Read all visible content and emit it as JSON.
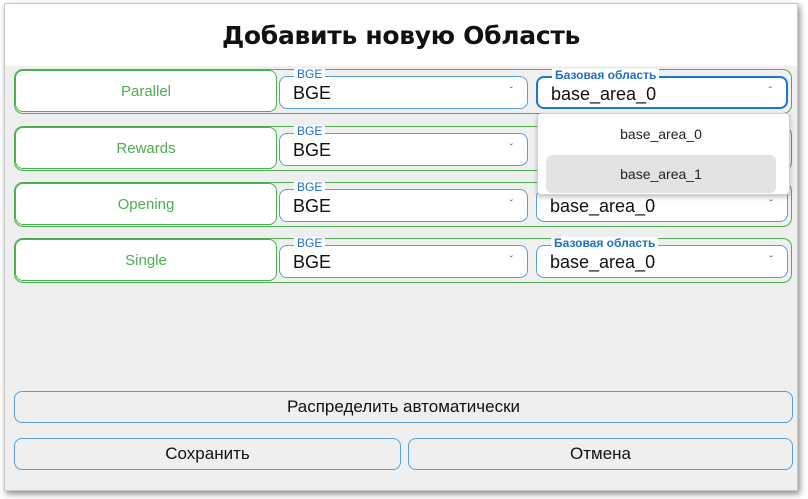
{
  "dialog": {
    "title": "Добавить новую Область"
  },
  "rows": [
    {
      "name": "Parallel",
      "bge_label": "BGE",
      "bge_value": "BGE",
      "area_label": "Базовая область",
      "area_value": "base_area_0"
    },
    {
      "name": "Rewards",
      "bge_label": "BGE",
      "bge_value": "BGE"
    },
    {
      "name": "Opening",
      "bge_label": "BGE",
      "bge_value": "BGE",
      "area_value": "base_area_0"
    },
    {
      "name": "Single",
      "bge_label": "BGE",
      "bge_value": "BGE",
      "area_label": "Базовая область",
      "area_value": "base_area_0"
    }
  ],
  "dropdown": {
    "options": [
      "base_area_0",
      "base_area_1"
    ],
    "hovered": "base_area_1"
  },
  "icons": {
    "chevron_down": "chevron-down-icon",
    "chevron_up": "chevron-up-icon"
  },
  "buttons": {
    "auto_distribute": "Распределить автоматически",
    "save": "Сохранить",
    "cancel": "Отмена"
  },
  "colors": {
    "row_border": "#4caf50",
    "field_border": "#5a9fd4",
    "focus_border": "#1976d2",
    "label_text": "#1e6fc2"
  }
}
